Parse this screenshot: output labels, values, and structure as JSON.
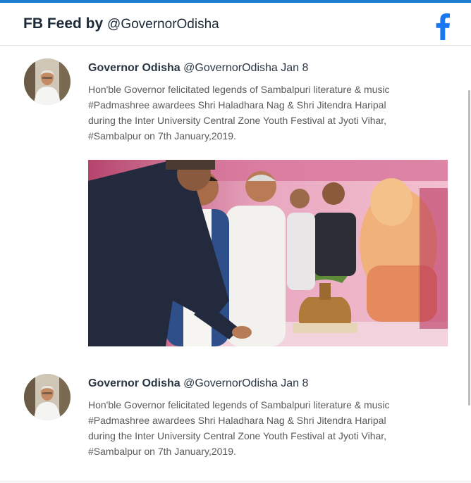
{
  "header": {
    "title_bold": "FB Feed by",
    "title_handle": "@GovernorOdisha",
    "icon": "facebook-icon"
  },
  "posts": [
    {
      "author": "Governor Odisha",
      "handle": "@GovernorOdisha",
      "date": "Jan 8",
      "text_lines": [
        "Hon'ble Governor felicitated legends of Sambalpuri literature & music",
        "#Padmashree awardees Shri Haladhara Nag & Shri Jitendra Haripal",
        "during the  Inter University Central Zone Youth Festival at Jyoti Vihar,",
        "#Sambalpur on 7th January,2019."
      ],
      "has_image": true
    },
    {
      "author": "Governor Odisha",
      "handle": "@GovernorOdisha",
      "date": "Jan 8",
      "text_lines": [
        "Hon'ble Governor felicitated legends of Sambalpuri literature & music",
        "#Padmashree awardees Shri Haladhara Nag & Shri Jitendra Haripal",
        "during the  Inter University Central Zone Youth Festival at Jyoti Vihar,",
        "#Sambalpur on 7th January,2019."
      ],
      "has_image": false
    }
  ],
  "colors": {
    "accent": "#1e7bd0",
    "facebook": "#1877f2",
    "title_text": "#1c2a3a",
    "body_text": "#5a5a5a"
  }
}
